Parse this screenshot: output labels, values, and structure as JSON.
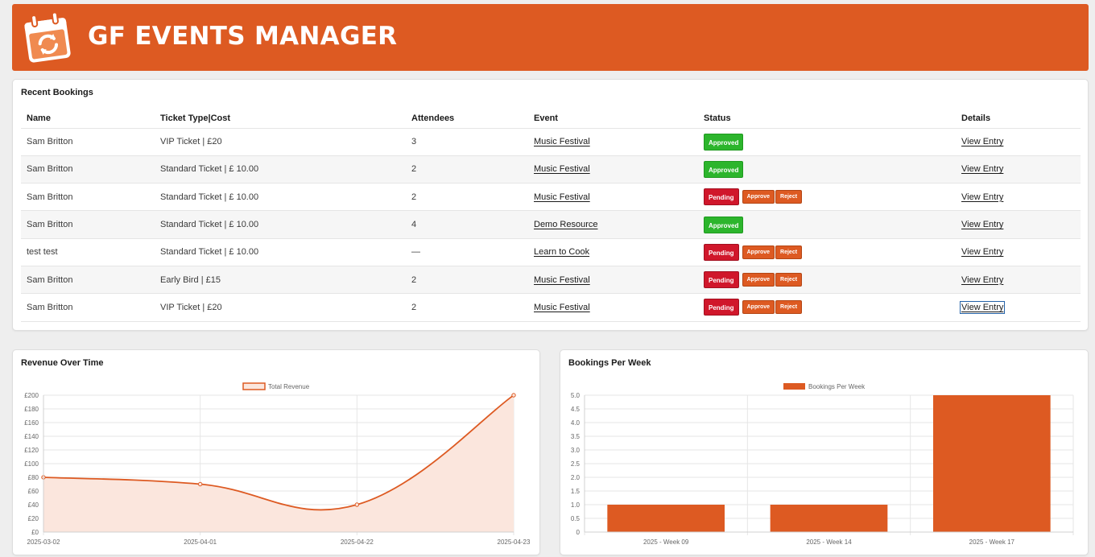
{
  "app": {
    "title": "GF EVENTS MANAGER",
    "accent": "#dd5a22",
    "logo_icon": "calendar-refresh-icon"
  },
  "recent_bookings": {
    "title": "Recent Bookings",
    "columns": [
      "Name",
      "Ticket Type|Cost",
      "Attendees",
      "Event",
      "Status",
      "Details"
    ],
    "rows": [
      {
        "name": "Sam Britton",
        "ticket": "VIP Ticket | £20",
        "attendees": "3",
        "event": "Music Festival",
        "status": "Approved",
        "details": "View Entry"
      },
      {
        "name": "Sam Britton",
        "ticket": "Standard Ticket | £ 10.00",
        "attendees": "2",
        "event": "Music Festival",
        "status": "Approved",
        "details": "View Entry"
      },
      {
        "name": "Sam Britton",
        "ticket": "Standard Ticket | £ 10.00",
        "attendees": "2",
        "event": "Music Festival",
        "status": "Pending",
        "details": "View Entry"
      },
      {
        "name": "Sam Britton",
        "ticket": "Standard Ticket | £ 10.00",
        "attendees": "4",
        "event": "Demo Resource",
        "status": "Approved",
        "details": "View Entry"
      },
      {
        "name": "test test",
        "ticket": "Standard Ticket | £ 10.00",
        "attendees": "—",
        "event": "Learn to Cook",
        "status": "Pending",
        "details": "View Entry"
      },
      {
        "name": "Sam Britton",
        "ticket": "Early Bird | £15",
        "attendees": "2",
        "event": "Music Festival",
        "status": "Pending",
        "details": "View Entry"
      },
      {
        "name": "Sam Britton",
        "ticket": "VIP Ticket | £20",
        "attendees": "2",
        "event": "Music Festival",
        "status": "Pending",
        "details": "View Entry"
      }
    ],
    "approve_label": "Approve",
    "reject_label": "Reject",
    "status_colors": {
      "Approved": "#2cb52c",
      "Pending": "#d0172b"
    }
  },
  "revenue_chart": {
    "title": "Revenue Over Time"
  },
  "bookings_chart": {
    "title": "Bookings Per Week"
  },
  "chart_data": [
    {
      "type": "area",
      "title": "Revenue Over Time",
      "x": [
        "2025-03-02",
        "2025-04-01",
        "2025-04-22",
        "2025-04-23"
      ],
      "series": [
        {
          "name": "Total Revenue",
          "values": [
            80,
            70,
            40,
            200
          ],
          "color": "#dd5a22",
          "fill": "#fbe6dd"
        }
      ],
      "ylim": [
        0,
        200
      ],
      "yticks": [
        "£0",
        "£20",
        "£40",
        "£60",
        "£80",
        "£100",
        "£120",
        "£140",
        "£160",
        "£180",
        "£200"
      ],
      "ytick_values": [
        0,
        20,
        40,
        60,
        80,
        100,
        120,
        140,
        160,
        180,
        200
      ],
      "legend": "top-center",
      "grid": true
    },
    {
      "type": "bar",
      "title": "Bookings Per Week",
      "categories": [
        "2025 - Week 09",
        "2025 - Week 14",
        "2025 - Week 17"
      ],
      "series": [
        {
          "name": "Bookings Per Week",
          "values": [
            1,
            1,
            5
          ],
          "color": "#dd5a22"
        }
      ],
      "ylim": [
        0,
        5
      ],
      "yticks": [
        "0",
        "0.5",
        "1.0",
        "1.5",
        "2.0",
        "2.5",
        "3.0",
        "3.5",
        "4.0",
        "4.5",
        "5.0"
      ],
      "ytick_values": [
        0,
        0.5,
        1,
        1.5,
        2,
        2.5,
        3,
        3.5,
        4,
        4.5,
        5
      ],
      "legend": "top-center",
      "grid": true
    }
  ]
}
